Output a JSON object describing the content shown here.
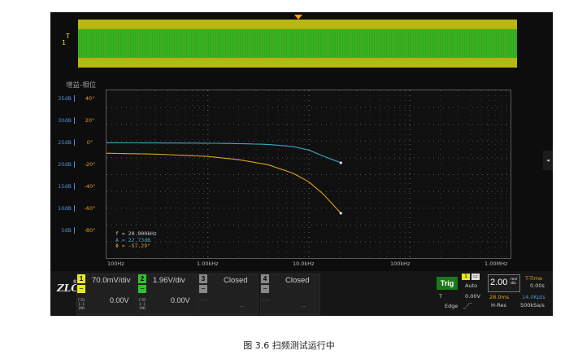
{
  "overview": {
    "channel_marker": "1",
    "trigger_marker": "T"
  },
  "graph": {
    "title": "增益-相位",
    "magnitude_labels": [
      "35dB",
      "30dB",
      "25dB",
      "20dB",
      "15dB",
      "10dB",
      "5dB"
    ],
    "phase_labels": [
      "40°",
      "20°",
      "0°",
      "-20°",
      "-40°",
      "-60°",
      "-80°"
    ],
    "x_labels": [
      "100Hz",
      "1.00kHz",
      "10.0kHz",
      "100kHz",
      "1.00MHz"
    ],
    "cursor": {
      "f": "f  = 20.900kHz",
      "a": "A  = 22.73dB",
      "phi": "Φ  = -57.29°"
    },
    "colors": {
      "gain": "#3fa7c9",
      "phase": "#e0a020"
    }
  },
  "chart_data": {
    "type": "line",
    "xscale": "log",
    "x": [
      100,
      300,
      1000,
      2000,
      4000,
      7000,
      10000,
      14000,
      20900
    ],
    "series": [
      {
        "values": [
          27.5,
          27.45,
          27.4,
          27.3,
          27.1,
          26.6,
          25.8,
          24.3,
          22.73
        ]
      },
      {
        "values": [
          0,
          -0.8,
          -3,
          -6,
          -11,
          -19,
          -27,
          -39,
          -57.29
        ]
      }
    ],
    "xlim": [
      100,
      1000000
    ],
    "ylim_gain": [
      0,
      40
    ],
    "ylim_phase": [
      -100,
      60
    ]
  },
  "channels": [
    {
      "num": "1",
      "scale": "70.0mV/div",
      "offset": "0.00V",
      "color": "#e8e820",
      "small": "FIR\n1:1\n1MΩ"
    },
    {
      "num": "2",
      "scale": "1.96V/div",
      "offset": "0.00V",
      "color": "#30c030",
      "small": "FIR\n1:1\n1MΩ"
    },
    {
      "num": "3",
      "scale": "Closed",
      "offset": "",
      "color": "#888888",
      "small": "-.--"
    },
    {
      "num": "4",
      "scale": "Closed",
      "offset": "",
      "color": "#888888",
      "small": "-.--"
    }
  ],
  "trigger": {
    "label": "Trig",
    "mode": "Auto",
    "type": "T",
    "level": "0.00V",
    "edge": "Edge"
  },
  "timebase": {
    "scale": "2.00",
    "unit": "ms/div",
    "ttime_label": "T-Time",
    "ttime": "0.00s",
    "record": "28.0ms",
    "points": "14.0Kpts",
    "hres": "H-Res",
    "rate": "500kSa/s"
  },
  "caption": "图 3.6   扫频测试运行中"
}
